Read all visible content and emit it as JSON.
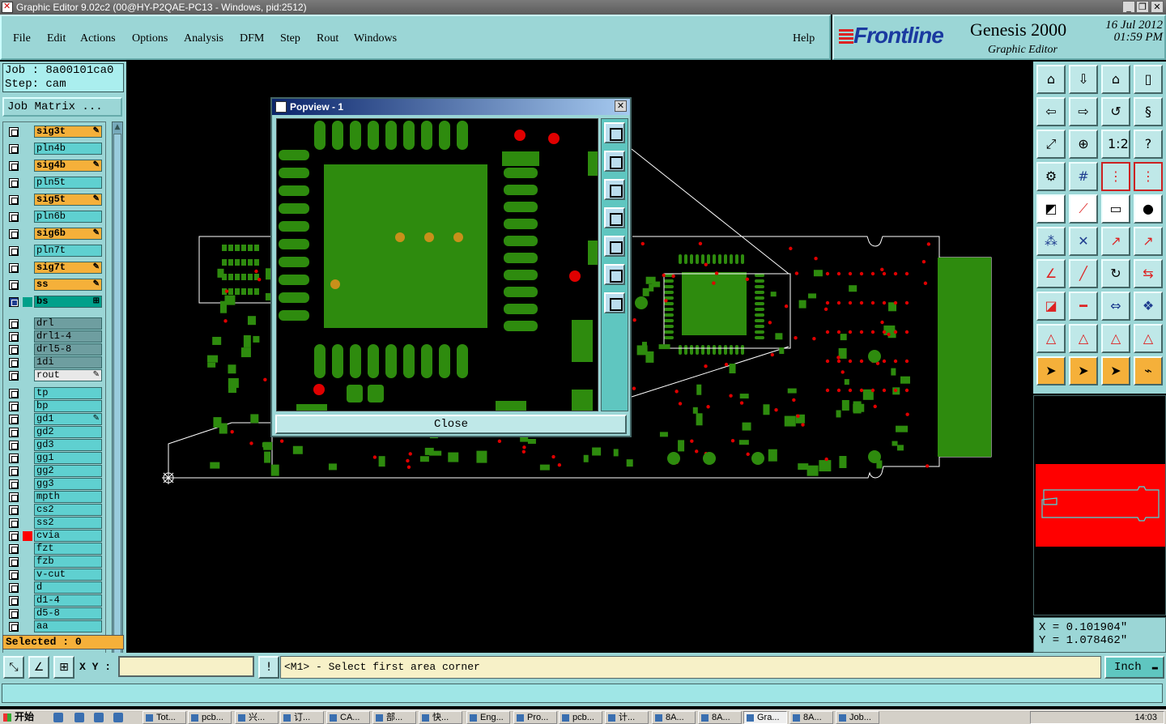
{
  "window": {
    "title": "Graphic Editor 9.02c2 (00@HY-P2QAE-PC13 - Windows, pid:2512)",
    "min": "_",
    "max": "❐",
    "close": "✕"
  },
  "menu": {
    "items": [
      "File",
      "Edit",
      "Actions",
      "Options",
      "Analysis",
      "DFM",
      "Step",
      "Rout",
      "Windows"
    ],
    "help": "Help"
  },
  "brand": {
    "logo": "Frontline",
    "product": "Genesis 2000",
    "subtitle": "Graphic Editor",
    "date": "16 Jul 2012",
    "time": "01:59 PM"
  },
  "job": {
    "job_line": "Job : 8a00101ca0",
    "step_line": "Step: cam",
    "job_matrix": "Job Matrix ..."
  },
  "layers": [
    {
      "name": "sig3t",
      "kind": "sig",
      "pen": true
    },
    {
      "name": "pln4b",
      "kind": "normal"
    },
    {
      "name": "sig4b",
      "kind": "sig",
      "pen": true
    },
    {
      "name": "pln5t",
      "kind": "normal"
    },
    {
      "name": "sig5t",
      "kind": "sig",
      "pen": true
    },
    {
      "name": "pln6b",
      "kind": "normal"
    },
    {
      "name": "sig6b",
      "kind": "sig",
      "pen": true
    },
    {
      "name": "pln7t",
      "kind": "normal"
    },
    {
      "name": "sig7t",
      "kind": "sig",
      "pen": true
    },
    {
      "name": "ss",
      "kind": "sig",
      "pen": true
    },
    {
      "name": "bs",
      "kind": "bs",
      "selected": true,
      "mark": "#00a08a"
    },
    {
      "name": "drl",
      "kind": "drl"
    },
    {
      "name": "drl1-4",
      "kind": "drl"
    },
    {
      "name": "drl5-8",
      "kind": "drl"
    },
    {
      "name": "1di",
      "kind": "drl"
    },
    {
      "name": "rout",
      "kind": "rout",
      "pen": true
    },
    {
      "name": "tp",
      "kind": "normal"
    },
    {
      "name": "bp",
      "kind": "normal"
    },
    {
      "name": "gd1",
      "kind": "normal",
      "pen": true
    },
    {
      "name": "gd2",
      "kind": "normal"
    },
    {
      "name": "gd3",
      "kind": "normal"
    },
    {
      "name": "gg1",
      "kind": "normal"
    },
    {
      "name": "gg2",
      "kind": "normal"
    },
    {
      "name": "gg3",
      "kind": "normal"
    },
    {
      "name": "mpth",
      "kind": "normal"
    },
    {
      "name": "cs2",
      "kind": "normal"
    },
    {
      "name": "ss2",
      "kind": "normal"
    },
    {
      "name": "cvia",
      "kind": "normal",
      "mark": "#ff0000"
    },
    {
      "name": "fzt",
      "kind": "normal"
    },
    {
      "name": "fzb",
      "kind": "normal"
    },
    {
      "name": "v-cut",
      "kind": "normal"
    },
    {
      "name": "d",
      "kind": "normal"
    },
    {
      "name": "d1-4",
      "kind": "normal"
    },
    {
      "name": "d5-8",
      "kind": "normal"
    },
    {
      "name": "aa",
      "kind": "normal"
    }
  ],
  "selected_label": "Selected : 0",
  "popview": {
    "title": "Popview - 1",
    "close_label": "Close"
  },
  "coords": {
    "x": "X = 0.101904\"",
    "y": "Y = 1.078462\""
  },
  "command": {
    "xy_label": "X Y :",
    "xy_value": "",
    "message": "<M1> - Select first area corner",
    "unit": "Inch"
  },
  "colors": {
    "pad": "#2e8b0e",
    "via": "#e00000",
    "outline": "#ffffff",
    "panel": "#9bd6d6",
    "signal_layer": "#f5b03a"
  },
  "taskbar": {
    "start": "开始",
    "items": [
      "Tot...",
      "pcb...",
      "兴...",
      "订...",
      "CA...",
      "部...",
      "快...",
      "Eng...",
      "Pro...",
      "pcb...",
      "计...",
      "8A...",
      "8A...",
      "Gra...",
      "8A...",
      "Job..."
    ],
    "active_index": 13,
    "clock": "14:03"
  }
}
